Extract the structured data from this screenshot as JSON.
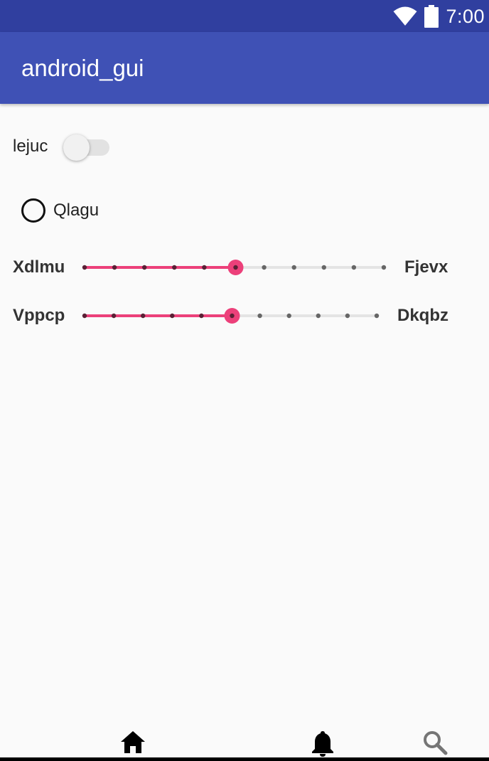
{
  "status_bar": {
    "time": "7:00",
    "icons": [
      "wifi-icon",
      "battery-icon"
    ],
    "background": "#303f9f"
  },
  "app_bar": {
    "title": "android_gui",
    "background": "#3f51b5"
  },
  "switch": {
    "label": "lejuc",
    "checked": false
  },
  "radio": {
    "label": "Qlagu",
    "checked": false
  },
  "sliders": [
    {
      "start_label": "Xdlmu",
      "end_label": "Fjevx",
      "steps": 10,
      "value": 5
    },
    {
      "start_label": "Vppcp",
      "end_label": "Dkqbz",
      "steps": 10,
      "value": 5
    }
  ],
  "accent_color": "#ec407a",
  "bottom_nav": {
    "items": [
      {
        "icon": "home-icon"
      },
      {
        "icon": "bell-icon"
      },
      {
        "icon": "search-icon"
      }
    ]
  }
}
